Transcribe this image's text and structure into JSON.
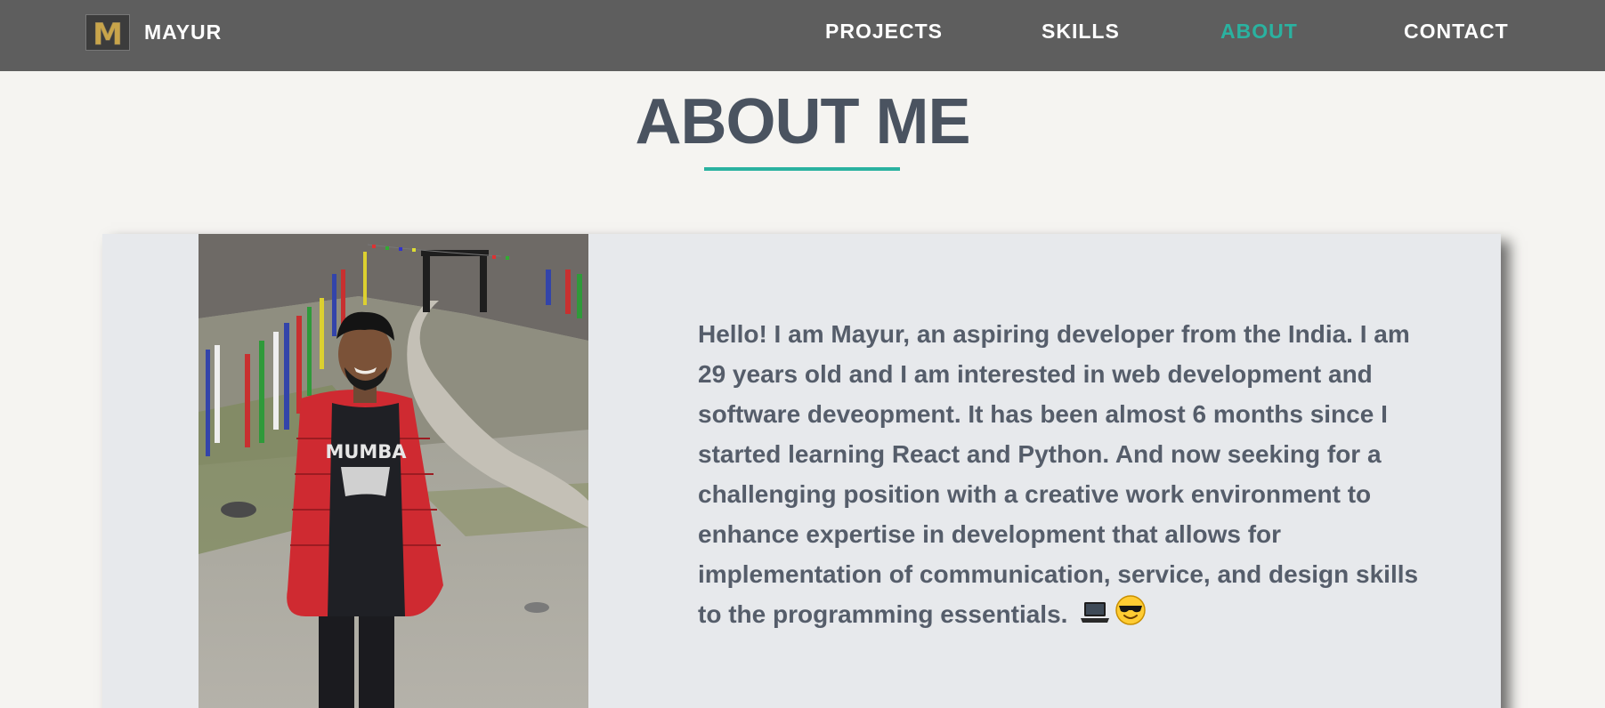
{
  "brand": {
    "logo_letter": "M",
    "name": "MAYUR"
  },
  "nav": {
    "items": [
      {
        "label": "PROJECTS",
        "active": false
      },
      {
        "label": "SKILLS",
        "active": false
      },
      {
        "label": "ABOUT",
        "active": true
      },
      {
        "label": "CONTACT",
        "active": false
      }
    ]
  },
  "about": {
    "title": "ABOUT ME",
    "bio": "Hello! I am Mayur, an aspiring developer from the India. I am 29 years old and I am interested in web development and software deveopment. It has been almost 6 months since I started learning React and Python. And now seeking for a challenging position with a creative work environment to enhance expertise in development that allows for implementation of communication, service, and design skills to the programming essentials.",
    "emojis": [
      "laptop-icon",
      "sunglasses-face-icon"
    ],
    "photo": {
      "shirt_text": "MUMBA"
    }
  },
  "colors": {
    "navbar_bg": "#5e5e5e",
    "accent": "#2ab2a0",
    "page_bg": "#f5f4f1",
    "card_bg": "#e7e9ec",
    "text": "#4a5360"
  }
}
